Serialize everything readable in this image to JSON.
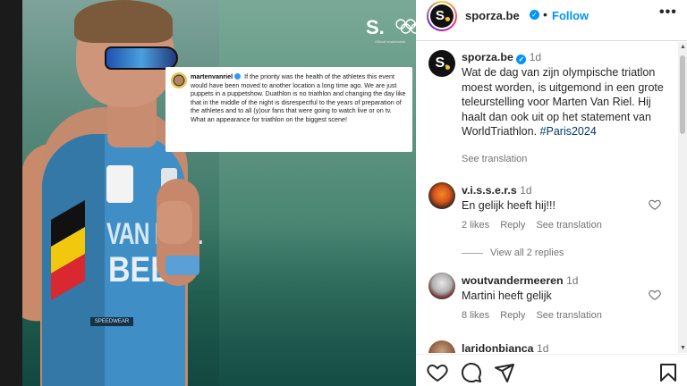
{
  "post": {
    "account": "sporza.be",
    "follow_label": "Follow",
    "more_label": "•••",
    "logo_letter": "S.",
    "image": {
      "brand_letter": "S.",
      "brand_sub": "Official broadcaster",
      "suit_name": "VAN RIEL",
      "suit_country": "BEL",
      "suit_sponsor": "SPEEDWEAR",
      "quote_handle": "martenvanriel",
      "quote_text": "If the priority was the health of the athletes this event would have been moved to another location a long time ago. We are just puppets in a puppetshow. Duathlon is no triathlon and changing the day like that in the middle of the night is disrespectful to the years of preparation of the athletes and to all (y)our fans that were going to watch live or on tv. What an appearance for triathlon on the biggest scene!"
    }
  },
  "caption": {
    "author": "sporza.be",
    "time": "1d",
    "text": "Wat de dag van zijn olympische triatlon moest worden, is uitgemond in een grote teleurstelling voor Marten Van Riel. Hij haalt dan ook uit op het statement van WorldTriathlon.",
    "hashtag": "#Paris2024",
    "see_translation": "See translation"
  },
  "comments": [
    {
      "author": "v.i.s.s.e.r.s",
      "time": "1d",
      "text": "En gelijk heeft hij!!!",
      "likes": "2 likes",
      "reply": "Reply",
      "see_translation": "See translation"
    },
    {
      "author": "woutvandermeeren",
      "time": "1d",
      "text": "Martini heeft gelijk",
      "likes": "8 likes",
      "reply": "Reply",
      "see_translation": "See translation"
    },
    {
      "author": "laridonbianca",
      "time": "1d"
    }
  ],
  "view_all_replies": "View all 2 replies",
  "icons": {
    "verified": "verified-badge-icon",
    "like": "heart-icon",
    "comment": "comment-icon",
    "share": "share-icon",
    "save": "bookmark-icon"
  },
  "colors": {
    "link_blue": "#0095f6",
    "hashtag": "#00376b",
    "muted": "#737373"
  }
}
